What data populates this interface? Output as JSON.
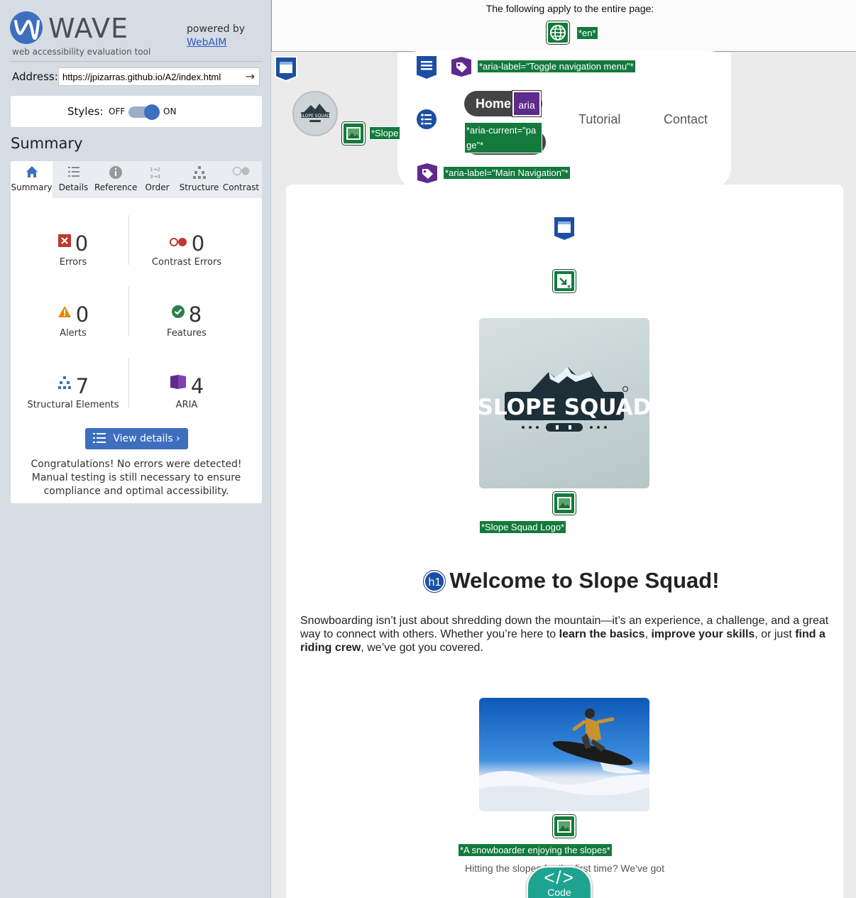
{
  "sidebar": {
    "brand": "WAVE",
    "tagline": "web accessibility evaluation tool",
    "powered_by": "powered by",
    "webaim_link": "WebAIM",
    "address_label": "Address:",
    "address_value": "https://jpizarras.github.io/A2/index.html",
    "styles_label": "Styles:",
    "styles_off": "OFF",
    "styles_on": "ON",
    "summary_title": "Summary",
    "tabs": [
      {
        "label": "Summary",
        "icon": "home-icon"
      },
      {
        "label": "Details",
        "icon": "list-icon"
      },
      {
        "label": "Reference",
        "icon": "info-icon"
      },
      {
        "label": "Order",
        "icon": "order-icon"
      },
      {
        "label": "Structure",
        "icon": "structure-icon"
      },
      {
        "label": "Contrast",
        "icon": "contrast-icon"
      }
    ],
    "stats": {
      "errors": {
        "count": "0",
        "label": "Errors"
      },
      "contrast_errors": {
        "count": "0",
        "label": "Contrast Errors"
      },
      "alerts": {
        "count": "0",
        "label": "Alerts"
      },
      "features": {
        "count": "8",
        "label": "Features"
      },
      "structural": {
        "count": "7",
        "label": "Structural Elements"
      },
      "aria": {
        "count": "4",
        "label": "ARIA"
      }
    },
    "view_details": "View details ›",
    "congrats": "Congratulations! No errors were detected! Manual testing is still necessary to ensure compliance and optimal accessibility."
  },
  "main": {
    "page_notice": "The following apply to the entire page:",
    "lang_tag": "*en*",
    "toggle_tag": "*aria-label=\"Toggle navigation menu\"*",
    "slope_tag": "*Slope",
    "home_label": "Home",
    "aria_chip": "aria",
    "current_tag": "*aria-current=\"page\"*",
    "nav_links": [
      "Tutorial",
      "Contact"
    ],
    "mainnav_tag": "*aria-label=\"Main Navigation\"*",
    "logo_alt_tag": "*Slope Squad Logo*",
    "logo_text": "SLOPE SQUAD",
    "h1_badge": "h1",
    "heading": "Welcome to Slope Squad!",
    "intro_1": "Snowboarding isn’t just about shredding down the mountain—it’s an experience, a challenge, and a great way to connect with others. Whether you’re here to ",
    "intro_b1": "learn the basics",
    "intro_2": ", ",
    "intro_b2": "improve your skills",
    "intro_3": ", or just ",
    "intro_b3": "find a riding crew",
    "intro_4": ", we’ve got you covered.",
    "snow_alt_tag": "*A snowboarder enjoying the slopes*",
    "caption": "Hitting the slopes for the first time? We've got",
    "code_symbol": "</>",
    "code_label": "Code"
  },
  "colors": {
    "accent": "#3e6fbf",
    "feature_green": "#147a3c",
    "aria_purple": "#5e2a8c",
    "error_red": "#c0392b"
  }
}
